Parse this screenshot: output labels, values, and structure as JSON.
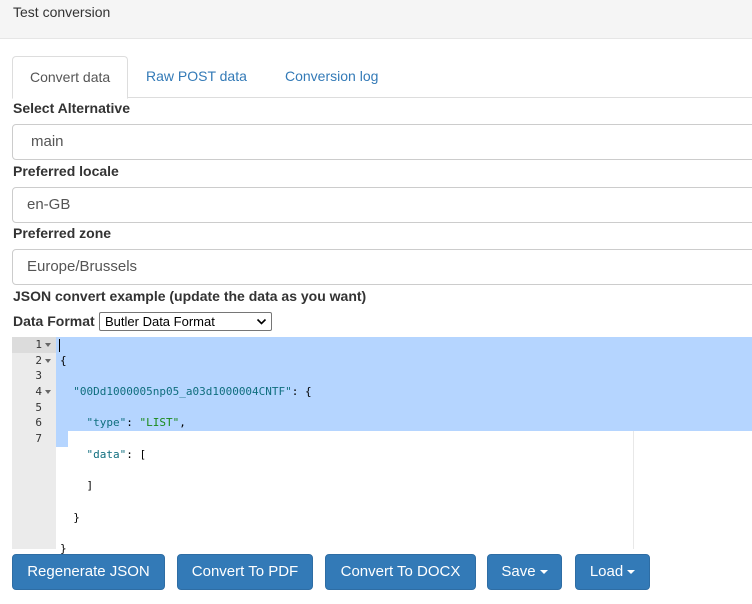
{
  "header": {
    "title": "Test conversion"
  },
  "tabs": [
    {
      "label": "Convert data",
      "active": true
    },
    {
      "label": "Raw POST data",
      "active": false
    },
    {
      "label": "Conversion log",
      "active": false
    }
  ],
  "form": {
    "alternative": {
      "label": "Select Alternative",
      "value": "main"
    },
    "locale": {
      "label": "Preferred locale",
      "value": "en-GB"
    },
    "zone": {
      "label": "Preferred zone",
      "value": "Europe/Brussels"
    },
    "json_heading": "JSON convert example (update the data as you want)",
    "data_format": {
      "label": "Data Format",
      "selected": "Butler Data Format"
    }
  },
  "editor": {
    "line_numbers": [
      "1",
      "2",
      "3",
      "4",
      "5",
      "6",
      "7"
    ],
    "tokens": {
      "l1_open": "{",
      "l2_key": "\"00Dd1000005np05_a03d1000004CNTF\"",
      "l2_rest": ": {",
      "l3_key": "\"type\"",
      "l3_sep": ": ",
      "l3_val": "\"LIST\"",
      "l3_end": ",",
      "l4_key": "\"data\"",
      "l4_rest": ": [",
      "l5": "]",
      "l6": "}",
      "l7": "}"
    }
  },
  "buttons": {
    "regenerate": "Regenerate JSON",
    "pdf": "Convert To PDF",
    "docx": "Convert To DOCX",
    "save": "Save",
    "load": "Load"
  },
  "colors": {
    "primary": "#337ab7",
    "selection": "#b5d5ff",
    "link": "#337ab7"
  }
}
